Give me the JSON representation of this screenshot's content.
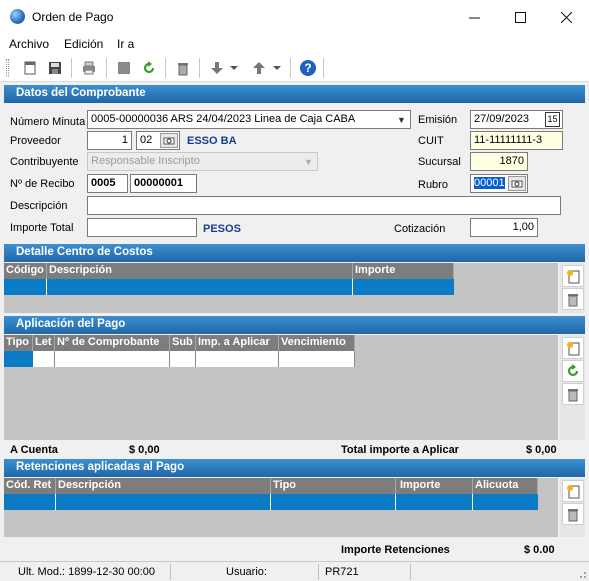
{
  "window": {
    "title": "Orden de Pago",
    "minimize": "—",
    "maximize": "☐",
    "close": "✕"
  },
  "menu": {
    "archivo": "Archivo",
    "edicion": "Edición",
    "ir_a": "Ir a"
  },
  "toolbar": {
    "icons": [
      "new-doc-icon",
      "save-icon",
      "print-icon",
      "stop-icon",
      "refresh-icon",
      "delete-icon",
      "move-down-icon",
      "move-up-icon",
      "help-icon"
    ]
  },
  "datos": {
    "header": "Datos del Comprobante",
    "numero_minuta_label": "Número Minuta",
    "numero_minuta_value": "0005-00000036  ARS  24/04/2023  Linea de Caja CABA",
    "emision_label": "Emisión",
    "emision_value": "27/09/2023",
    "calendar_glyph": "15",
    "proveedor_label": "Proveedor",
    "proveedor_code": "1",
    "proveedor_sub": "02",
    "proveedor_name": "ESSO BA",
    "cuit_label": "CUIT",
    "cuit_value": "11-11111111-3",
    "contribuyente_label": "Contribuyente",
    "contribuyente_value": "Responsable Inscripto",
    "sucursal_label": "Sucursal",
    "sucursal_value": "1870",
    "recibo_label": "Nº de Recibo",
    "recibo_pv": "0005",
    "recibo_num": "00000001",
    "rubro_label": "Rubro",
    "rubro_value": "00001",
    "descripcion_label": "Descripción",
    "descripcion_value": "",
    "importe_total_label": "Importe Total",
    "importe_total_value": "",
    "moneda": "PESOS",
    "cotizacion_label": "Cotización",
    "cotizacion_value": "1,00"
  },
  "costos": {
    "header": "Detalle Centro de Costos",
    "columns": [
      "Código",
      "Descripción",
      "Importe"
    ]
  },
  "aplicacion": {
    "header": "Aplicación del Pago",
    "columns": [
      "Tipo",
      "Let",
      "Nº de Comprobante",
      "Sub",
      "Imp. a Aplicar",
      "Vencimiento"
    ],
    "a_cuenta_label": "A Cuenta",
    "a_cuenta_value": "$ 0,00",
    "total_label": "Total importe a Aplicar",
    "total_value": "$ 0,00"
  },
  "retenciones": {
    "header": "Retenciones aplicadas al Pago",
    "columns": [
      "Cód. Ret",
      "Descripción",
      "Tipo",
      "Importe",
      "Alicuota"
    ],
    "importe_label": "Importe Retenciones",
    "importe_value": "$ 0.00"
  },
  "status": {
    "ult_mod": "Ult. Mod.: 1899-12-30 00:00",
    "usuario": "Usuario:",
    "code": "PR721"
  }
}
